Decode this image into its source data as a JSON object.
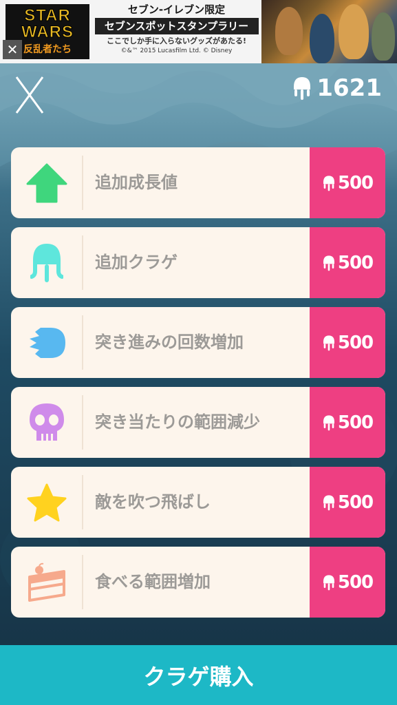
{
  "ad": {
    "logo_text": "STAR WARS",
    "logo_sub": "反乱者たち",
    "line1": "セブン-イレブン限定",
    "line2": "セブンスポットスタンプラリー",
    "line3": "ここでしか手に入らないグッズがあたる!",
    "line4": "©&™ 2015 Lucasfilm Ltd. © Disney",
    "close_glyph": "✕"
  },
  "header": {
    "close_icon": "x-icon",
    "coin_icon": "jellyfish-icon",
    "coins": "1621"
  },
  "items": [
    {
      "icon": "green-arrow-up-icon",
      "label": "追加成長値",
      "price": "500",
      "color": "#3fd67d"
    },
    {
      "icon": "jellyfish-icon",
      "label": "追加クラゲ",
      "price": "500",
      "color": "#5ee6dc"
    },
    {
      "icon": "blue-chomper-icon",
      "label": "突き進みの回数増加",
      "price": "500",
      "color": "#58b8f0"
    },
    {
      "icon": "skull-icon",
      "label": "突き当たりの範囲減少",
      "price": "500",
      "color": "#cf8bea"
    },
    {
      "icon": "star-icon",
      "label": "敵を吹つ飛ばし",
      "price": "500",
      "color": "#ffd21f"
    },
    {
      "icon": "cake-icon",
      "label": "食べる範囲増加",
      "price": "500",
      "color": "#f6a98c"
    }
  ],
  "footer": {
    "buy_label": "クラゲ購入"
  },
  "colors": {
    "price_bg": "#ee3f82",
    "buy_bg": "#1db8c6",
    "card_bg": "#fdf5ec"
  }
}
